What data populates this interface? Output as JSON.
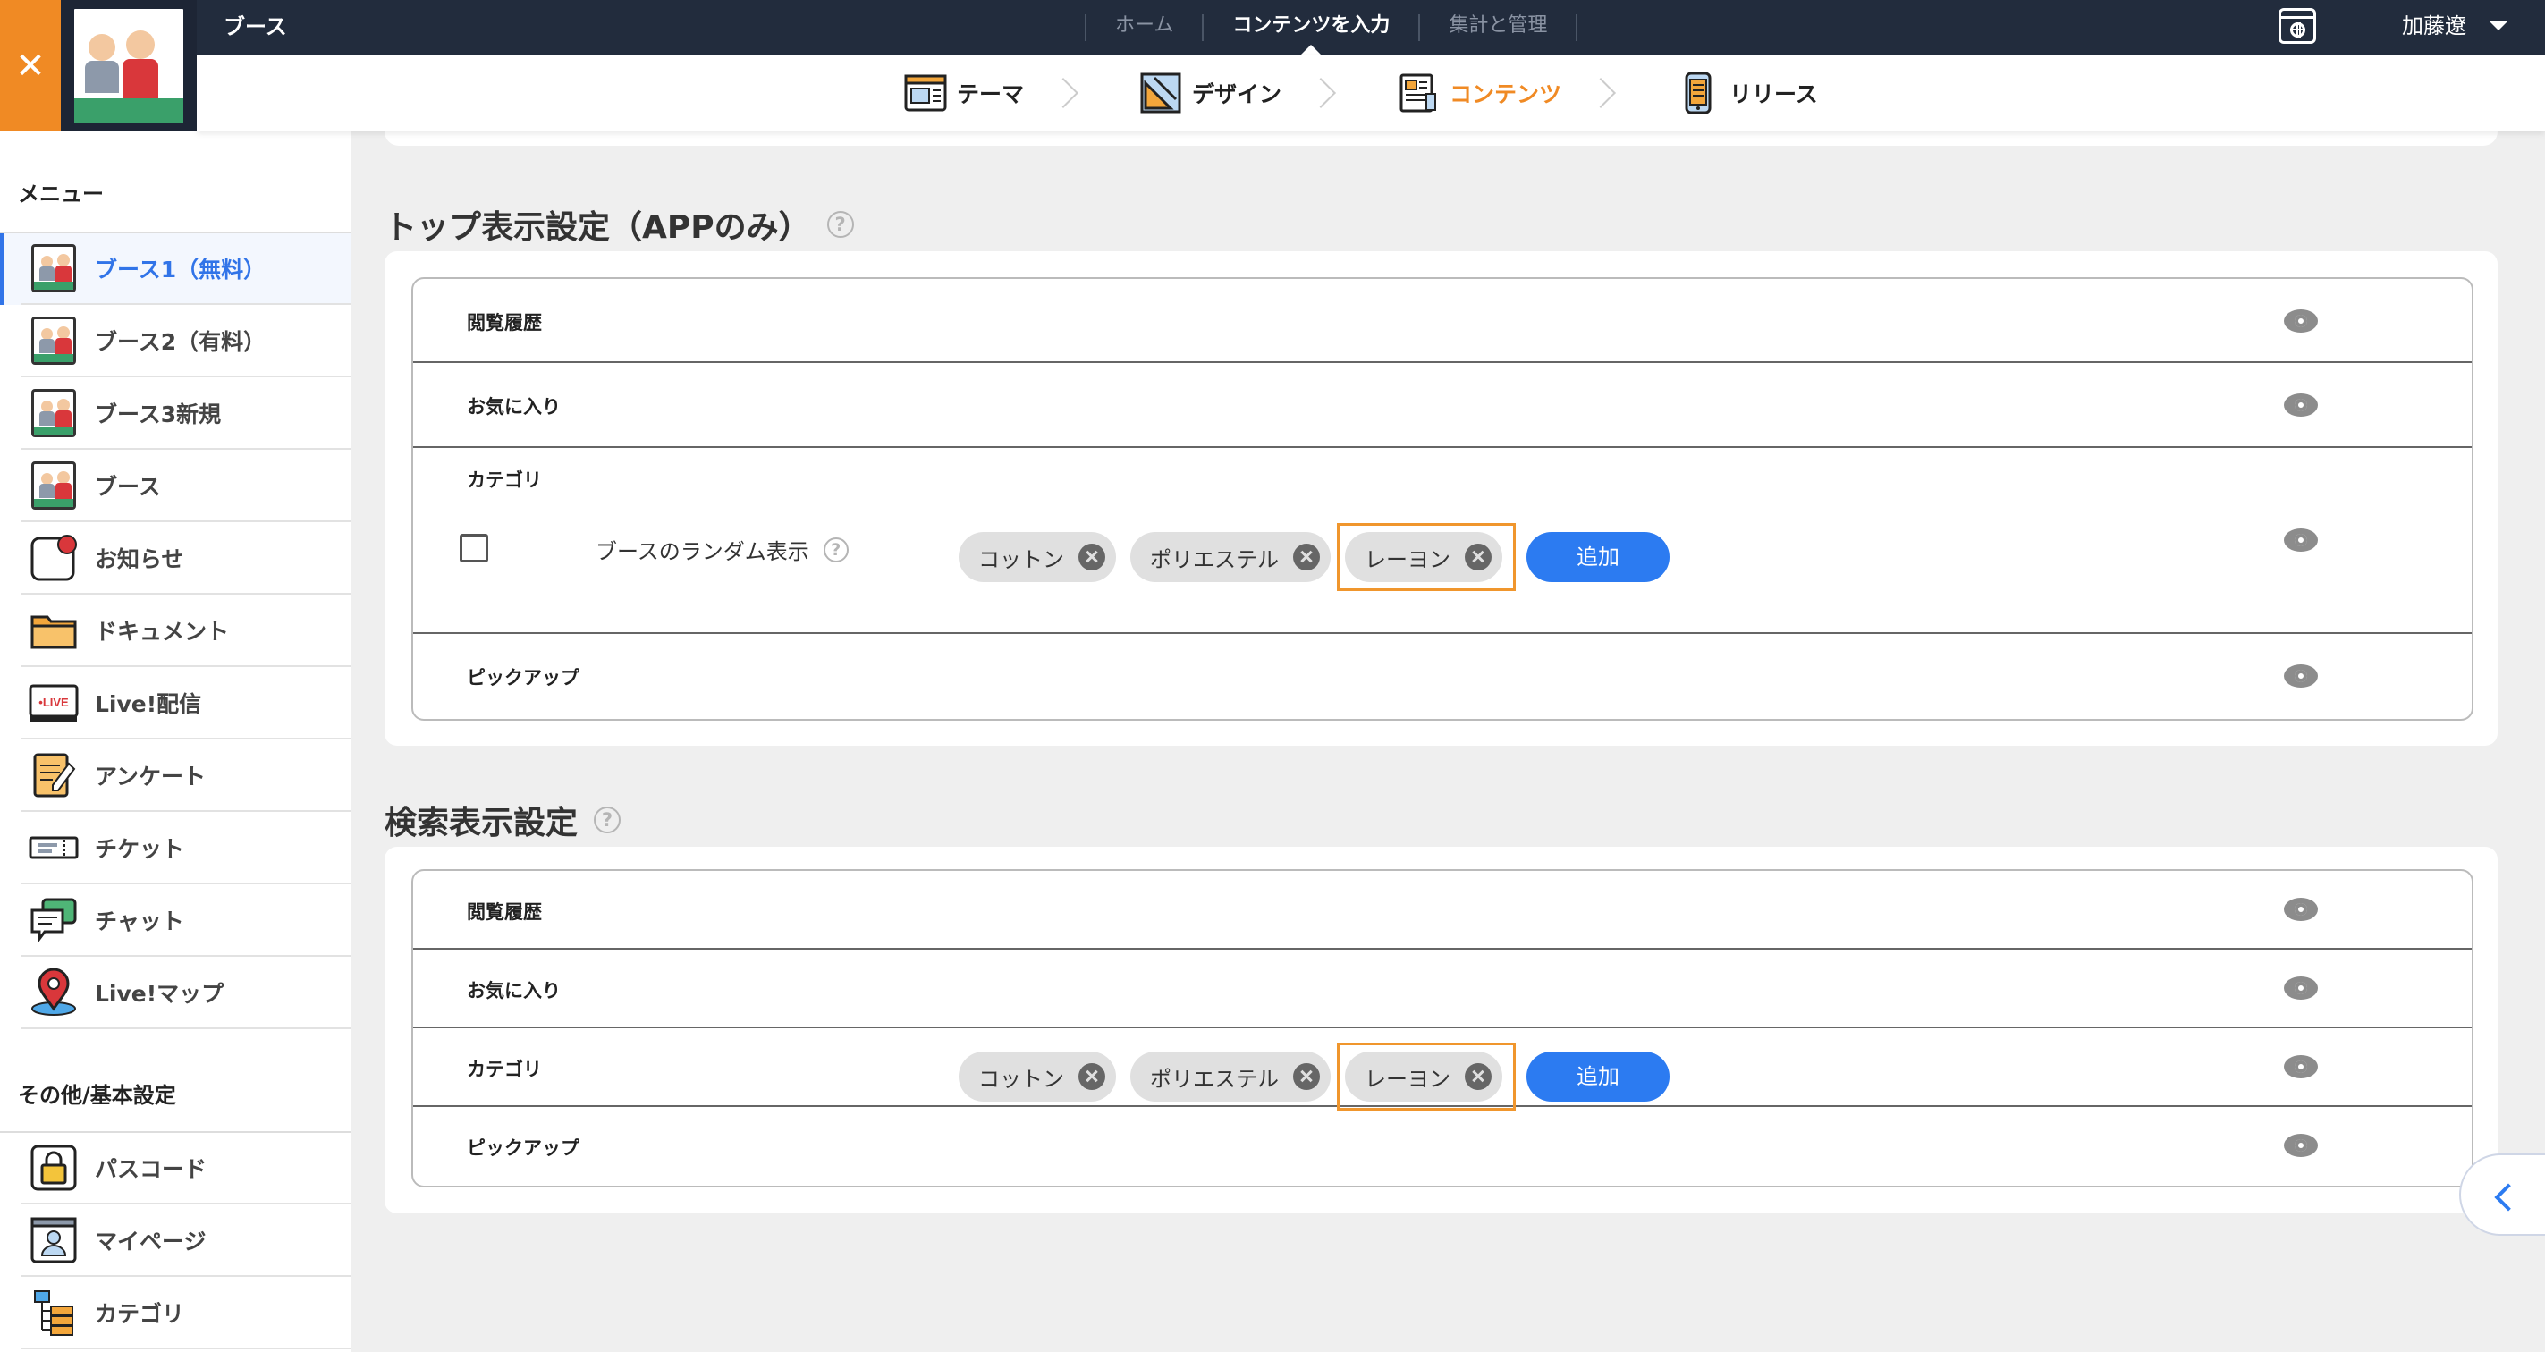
{
  "app": {
    "title": "ブース"
  },
  "topnav": {
    "items": [
      "ホーム",
      "コンテンツを入力",
      "集計と管理"
    ],
    "active_index": 1
  },
  "user": {
    "name": "加藤遼"
  },
  "steps": [
    {
      "label": "テーマ",
      "icon": "theme-icon",
      "active": false
    },
    {
      "label": "デザイン",
      "icon": "design-icon",
      "active": false
    },
    {
      "label": "コンテンツ",
      "icon": "contents-icon",
      "active": true
    },
    {
      "label": "リリース",
      "icon": "release-icon",
      "active": false
    }
  ],
  "sidebar": {
    "menu_heading": "メニュー",
    "items": [
      {
        "label": "ブース1（無料）",
        "icon": "booth-icon",
        "active": true
      },
      {
        "label": "ブース2（有料）",
        "icon": "booth-icon",
        "active": false
      },
      {
        "label": "ブース3新規",
        "icon": "booth-icon",
        "active": false
      },
      {
        "label": "ブース",
        "icon": "booth-icon",
        "active": false
      },
      {
        "label": "お知らせ",
        "icon": "notification-icon",
        "active": false
      },
      {
        "label": "ドキュメント",
        "icon": "folder-icon",
        "active": false
      },
      {
        "label": "Live!配信",
        "icon": "live-icon",
        "active": false
      },
      {
        "label": "アンケート",
        "icon": "survey-icon",
        "active": false
      },
      {
        "label": "チケット",
        "icon": "ticket-icon",
        "active": false
      },
      {
        "label": "チャット",
        "icon": "chat-icon",
        "active": false
      },
      {
        "label": "Live!マップ",
        "icon": "map-pin-icon",
        "active": false
      }
    ],
    "other_heading": "その他/基本設定",
    "other_items": [
      {
        "label": "パスコード",
        "icon": "lock-icon"
      },
      {
        "label": "マイページ",
        "icon": "profile-icon"
      },
      {
        "label": "カテゴリ",
        "icon": "category-icon"
      }
    ]
  },
  "top_display": {
    "title": "トップ表示設定（APPのみ）",
    "help": "?",
    "rows": {
      "history": "閲覧履歴",
      "favorites": "お気に入り",
      "category": "カテゴリ",
      "random_label": "ブースのランダム表示",
      "random_checked": false,
      "pickup": "ピックアップ"
    },
    "chips": [
      "コットン",
      "ポリエステル",
      "レーヨン"
    ],
    "add_label": "追加"
  },
  "search_display": {
    "title": "検索表示設定",
    "help": "?",
    "rows": {
      "history": "閲覧履歴",
      "favorites": "お気に入り",
      "category": "カテゴリ",
      "pickup": "ピックアップ"
    },
    "chips": [
      "コットン",
      "ポリエステル",
      "レーヨン"
    ],
    "add_label": "追加"
  },
  "colors": {
    "accent": "#f08a24",
    "primary": "#2c7bf1",
    "topbar": "#222c3d"
  }
}
